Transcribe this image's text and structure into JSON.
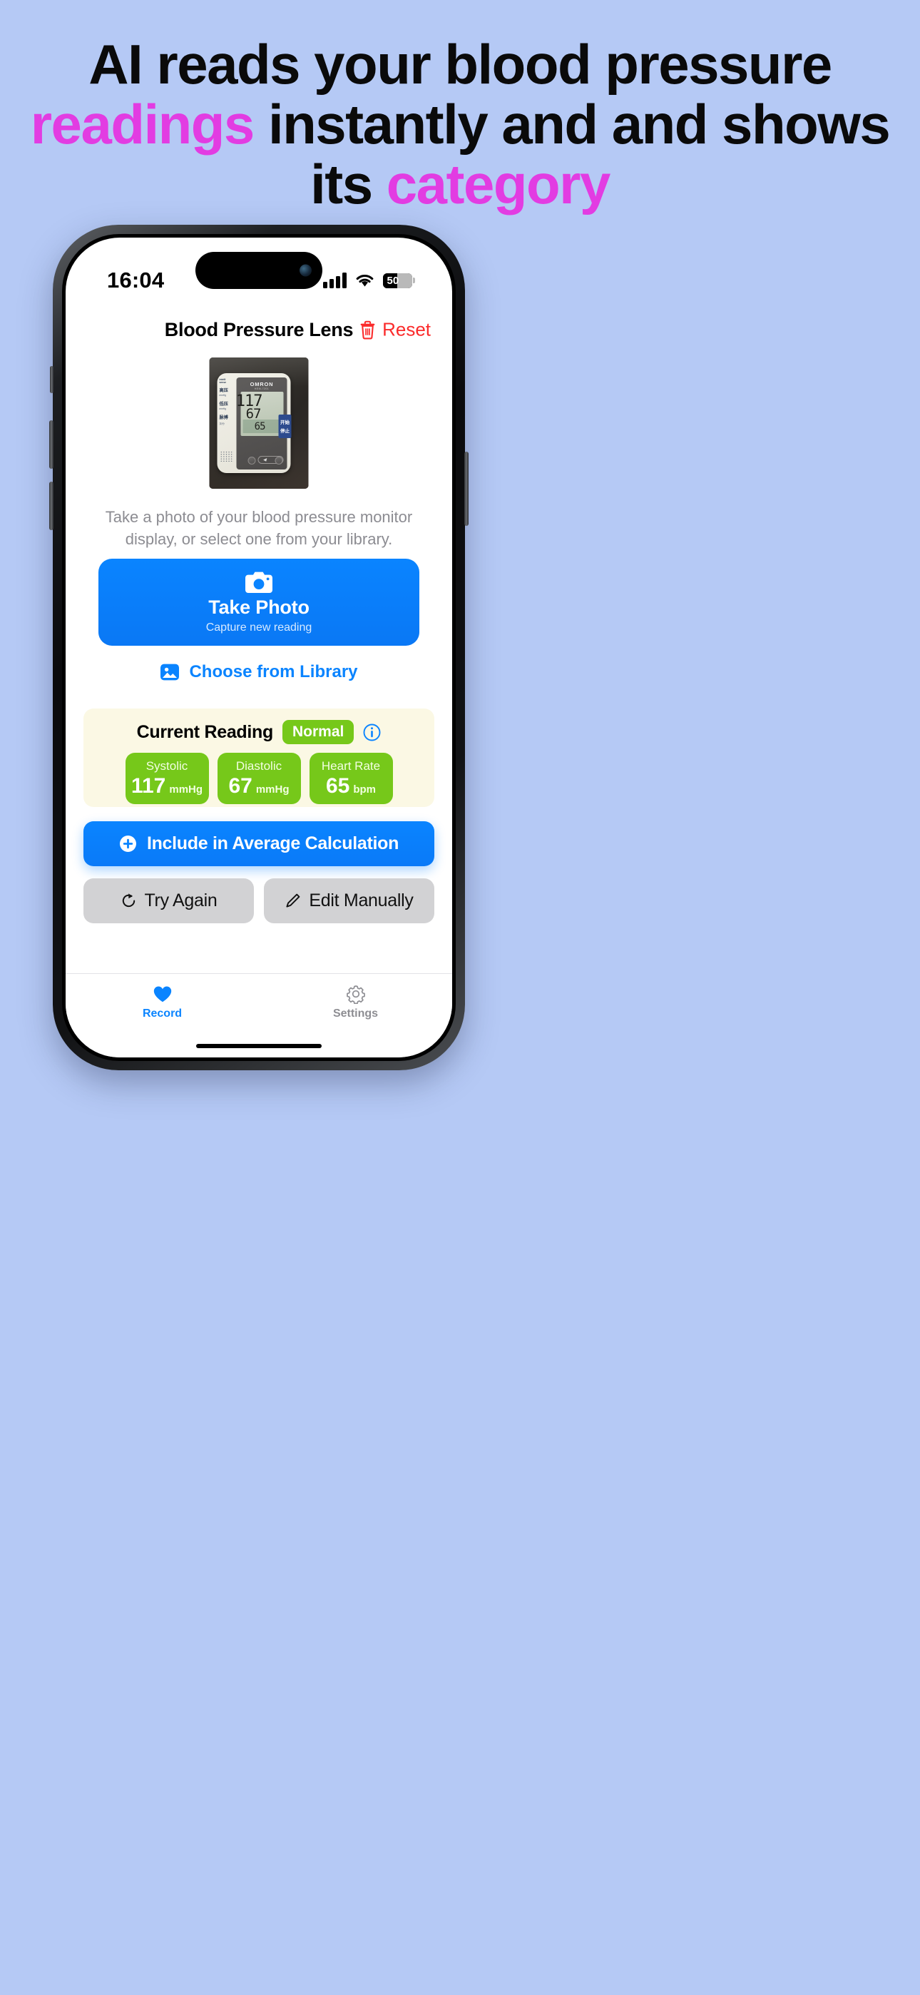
{
  "headline": {
    "part1": "AI reads your blood pressure ",
    "accent1": "readings",
    "part2": " instantly and and shows its ",
    "accent2": "category",
    "accent_color": "#e23ce2"
  },
  "phone": {
    "status_bar": {
      "time": "16:04",
      "signal_icon": "cellular-bars-icon",
      "wifi_icon": "wifi-icon",
      "battery_level": "50",
      "battery_icon": "battery-icon"
    },
    "app": {
      "header": {
        "title": "Blood Pressure Lens",
        "reset_label": "Reset",
        "reset_icon": "trash-icon",
        "reset_color": "#fb2b2b"
      },
      "photo": {
        "alt": "blood-pressure-monitor-photo",
        "brand": "OMRON",
        "model": "HEM-7201",
        "logo_line1": "intelli",
        "logo_line2": "sense",
        "label_systolic": "高压",
        "unit_systolic": "mmHg",
        "label_diastolic": "低压",
        "unit_diastolic": "mmHg",
        "label_pulse": "脉搏",
        "unit_pulse": "次/分",
        "lcd_systolic": "117",
        "lcd_diastolic": "67",
        "lcd_pulse": "65",
        "start_button_line1": "开始",
        "start_button_line2": "停止"
      },
      "instruction": "Take a photo of your blood pressure monitor display, or select one from your library.",
      "take_photo": {
        "icon": "camera-icon",
        "title": "Take Photo",
        "subtitle": "Capture new reading",
        "color": "#0a84ff"
      },
      "choose_library": {
        "icon": "photo-library-icon",
        "label": "Choose from Library",
        "color": "#0a84ff"
      },
      "current_reading": {
        "title": "Current Reading",
        "badge": "Normal",
        "badge_color": "#76c81a",
        "info_icon": "info-circle-icon",
        "card_color": "#fbf8e4",
        "tiles": [
          {
            "label": "Systolic",
            "value": "117",
            "unit": "mmHg"
          },
          {
            "label": "Diastolic",
            "value": "67",
            "unit": "mmHg"
          },
          {
            "label": "Heart Rate",
            "value": "65",
            "unit": "bpm"
          }
        ]
      },
      "include_button": {
        "icon": "plus-circle-icon",
        "label": "Include in Average Calculation"
      },
      "secondary_buttons": [
        {
          "icon": "refresh-icon",
          "label": "Try Again"
        },
        {
          "icon": "pencil-icon",
          "label": "Edit Manually"
        }
      ],
      "tab_bar": [
        {
          "icon": "heart-icon",
          "label": "Record",
          "active": true
        },
        {
          "icon": "gear-icon",
          "label": "Settings",
          "active": false
        }
      ]
    }
  }
}
